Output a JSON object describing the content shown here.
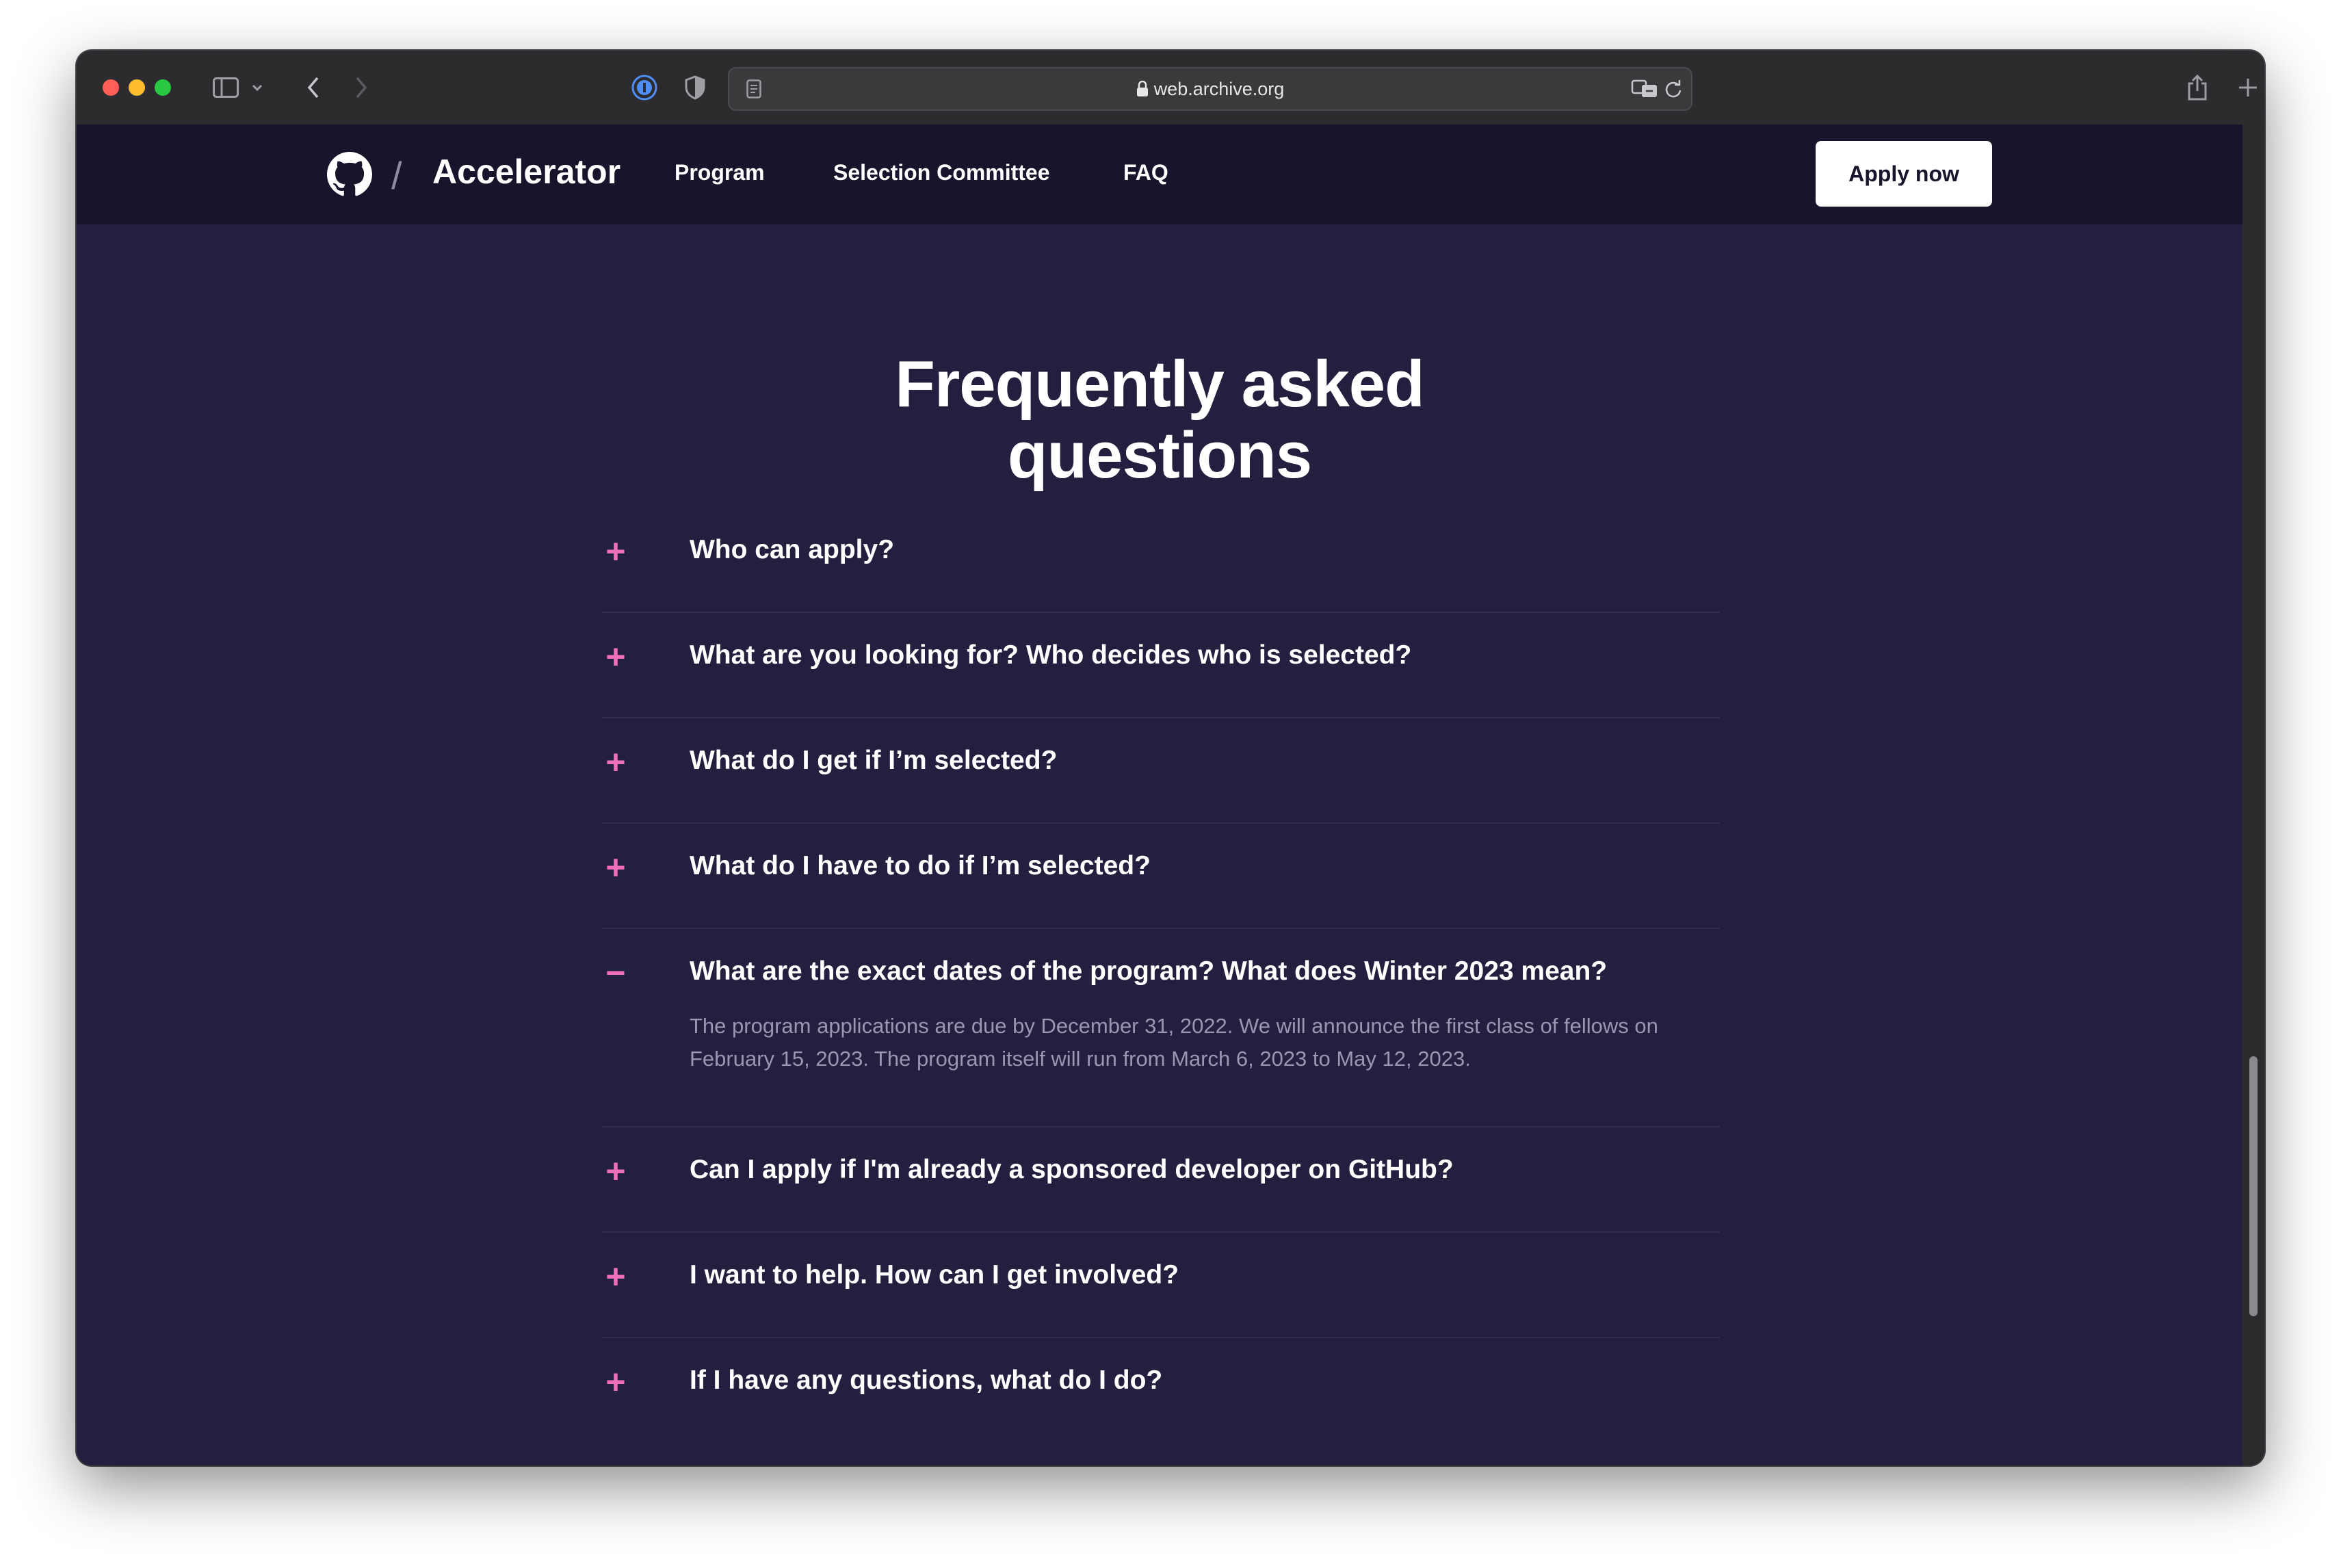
{
  "browser": {
    "url": "web.archive.org",
    "traffic_colors": {
      "close": "#ff5f57",
      "minimize": "#febc2e",
      "zoom": "#28c840"
    }
  },
  "site": {
    "brand_separator": "/",
    "brand_name": "Accelerator",
    "nav": {
      "program": "Program",
      "selection_committee": "Selection Committee",
      "faq": "FAQ"
    },
    "apply_label": "Apply now",
    "accent": "#f06fbb",
    "background": "#221f3f"
  },
  "faq": {
    "heading_line1": "Frequently asked",
    "heading_line2": "questions",
    "items": [
      {
        "toggle": "+",
        "question": "Who can apply?"
      },
      {
        "toggle": "+",
        "question": "What are you looking for? Who decides who is selected?"
      },
      {
        "toggle": "+",
        "question": "What do I get if I’m selected?"
      },
      {
        "toggle": "+",
        "question": "What do I have to do if I’m selected?"
      },
      {
        "toggle": "−",
        "question": "What are the exact dates of the program? What does Winter 2023 mean?",
        "answer": "The program applications are due by December 31, 2022. We will announce the first class of fellows on February 15, 2023. The program itself will run from March 6, 2023 to May 12, 2023."
      },
      {
        "toggle": "+",
        "question": "Can I apply if I'm already a sponsored developer on GitHub?"
      },
      {
        "toggle": "+",
        "question": "I want to help. How can I get involved?"
      },
      {
        "toggle": "+",
        "question": "If I have any questions, what do I do?"
      }
    ]
  }
}
